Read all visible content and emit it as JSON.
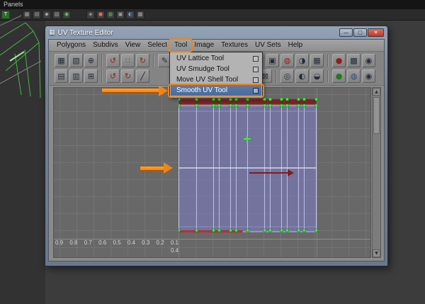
{
  "colors": {
    "annotation-orange": "#ef8418",
    "selection-blue": "#5d7ba8",
    "uv-fill": "#7d7dd2",
    "vertex-green": "#38f23c",
    "seam-maroon": "#7c2026",
    "close-red": "#bb3a28"
  },
  "viewport": {
    "panels_label": "Panels"
  },
  "topbar": {
    "icons": [
      {
        "name": "toggle-ui-icon",
        "glyph": "T",
        "cls": "greenbg"
      },
      {
        "gap": 14
      },
      {
        "name": "snap-grid-icon",
        "glyph": "▦"
      },
      {
        "name": "snap-curve-icon",
        "glyph": "▤"
      },
      {
        "name": "snap-point-icon",
        "glyph": "◆"
      },
      {
        "name": "snap-plane-icon",
        "glyph": "▧"
      },
      {
        "name": "make-live-icon",
        "glyph": "◉",
        "cls": "green"
      },
      {
        "gap": 18
      },
      {
        "name": "history-icon",
        "glyph": "◈"
      },
      {
        "name": "render-icon",
        "glyph": "●",
        "cls": "red"
      },
      {
        "name": "ipr-render-icon",
        "glyph": "◍",
        "cls": "green"
      },
      {
        "name": "render-settings-icon",
        "glyph": "▣"
      },
      {
        "name": "paint-effects-icon",
        "glyph": "◐",
        "cls": "blue"
      },
      {
        "name": "hypershade-icon",
        "glyph": "▩"
      }
    ]
  },
  "window": {
    "title": "UV Texture Editor",
    "title_icon": "▦",
    "controls": [
      {
        "name": "minimize",
        "glyph": "—"
      },
      {
        "name": "maximize",
        "glyph": "▢"
      },
      {
        "name": "close",
        "glyph": "✕"
      }
    ],
    "menus": [
      {
        "label": "Polygons"
      },
      {
        "label": "Subdivs"
      },
      {
        "label": "View"
      },
      {
        "label": "Select"
      },
      {
        "label": "Tool",
        "highlighted": true
      },
      {
        "label": "Image"
      },
      {
        "label": "Textures"
      },
      {
        "label": "UV Sets"
      },
      {
        "label": "Help"
      }
    ],
    "tool_menu_items": [
      {
        "label": "UV Lattice Tool",
        "selected": false
      },
      {
        "label": "UV Smudge Tool",
        "selected": false
      },
      {
        "label": "Move UV Shell Tool",
        "selected": false
      },
      {
        "label": "Smooth UV Tool",
        "selected": true
      }
    ]
  },
  "toolbar": {
    "row1": [
      {
        "name": "uv-lattice-tool-icon",
        "glyph": "▦"
      },
      {
        "name": "uv-smudge-tool-icon",
        "glyph": "▧"
      },
      {
        "name": "move-uv-shell-tool-icon",
        "glyph": "⊕"
      },
      {
        "sep": true
      },
      {
        "name": "rotate-uvs-ccw-icon",
        "glyph": "↺",
        "cls": "red"
      },
      {
        "name": "flip-uvs-icon",
        "glyph": "∷",
        "cls": "green"
      },
      {
        "name": "rotate-uvs-cw-icon",
        "glyph": "↻",
        "cls": "red"
      },
      {
        "sep": true
      },
      {
        "name": "cut-uv-edges-icon",
        "glyph": "✎"
      },
      {
        "gap": true
      },
      {
        "name": "snap-uvs-icon",
        "glyph": "⁙"
      },
      {
        "name": "align-uvs-icon",
        "glyph": "⁘"
      },
      {
        "name": "layout-uvs-icon",
        "glyph": "∷"
      },
      {
        "sep": true
      },
      {
        "name": "display-image-icon",
        "glyph": "▣"
      },
      {
        "name": "filtered-image-icon",
        "glyph": "◍",
        "cls": "red"
      },
      {
        "name": "dim-image-icon",
        "glyph": "◑"
      },
      {
        "name": "view-grid-icon",
        "glyph": "▦"
      },
      {
        "sep": true
      },
      {
        "name": "texture-red-icon",
        "glyph": "●",
        "cls": "red"
      },
      {
        "name": "texture-checker-icon",
        "glyph": "▩"
      },
      {
        "name": "texture-sphere-icon",
        "glyph": "◉"
      }
    ],
    "row2": [
      {
        "name": "copy-uvs-icon",
        "glyph": "▤"
      },
      {
        "name": "paste-uvs-icon",
        "glyph": "▥"
      },
      {
        "name": "paste-u-v-icon",
        "glyph": "⊞"
      },
      {
        "sep": true
      },
      {
        "name": "rotate-selected-ccw-icon",
        "glyph": "↺",
        "cls": "red"
      },
      {
        "name": "rotate-selected-cw-icon",
        "glyph": "↻",
        "cls": "red"
      },
      {
        "name": "separate-uvs-icon",
        "glyph": "╱"
      },
      {
        "gap": true
      },
      {
        "name": "uv-snapshot-icon",
        "glyph": "▣"
      },
      {
        "name": "tile-display-icon",
        "glyph": "⊟"
      },
      {
        "name": "grid-display-icon",
        "glyph": "⊠"
      },
      {
        "sep": true
      },
      {
        "name": "isolate-select-icon",
        "glyph": "◎"
      },
      {
        "name": "add-to-isolate-icon",
        "glyph": "◐"
      },
      {
        "name": "remove-from-isolate-icon",
        "glyph": "◒"
      },
      {
        "sep": true
      },
      {
        "name": "shaded-uvs-icon",
        "glyph": "●",
        "cls": "green"
      },
      {
        "name": "distortion-icon",
        "glyph": "◍",
        "cls": "blue"
      },
      {
        "name": "texture-borders-icon",
        "glyph": "◉"
      }
    ]
  },
  "canvas": {
    "axis_labels": [
      "0.9",
      "0.8",
      "0.7",
      "0.6",
      "0.5",
      "0.4",
      "0.3",
      "0.2",
      "0.1"
    ],
    "origin_label": "0.4"
  },
  "scrollbar": {
    "up_glyph": "▲",
    "down_glyph": "▼"
  }
}
